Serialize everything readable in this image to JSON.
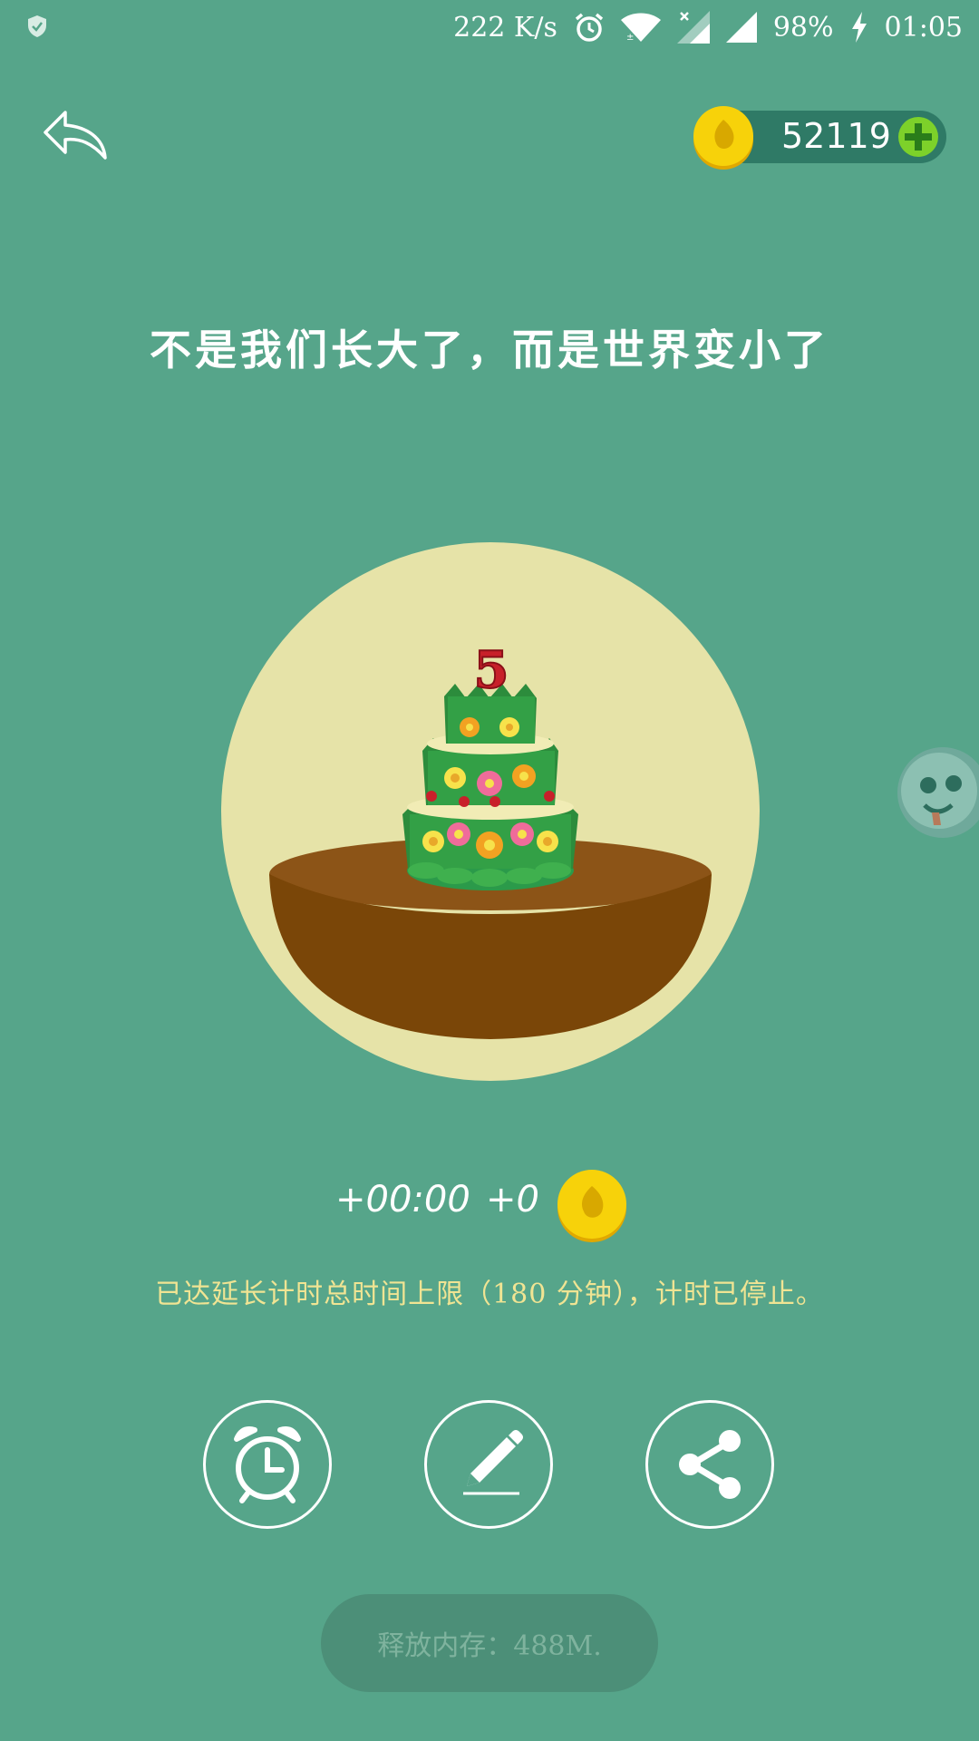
{
  "status_bar": {
    "network_speed": "222 K/s",
    "battery": "98%",
    "time": "01:05",
    "icons": [
      "shield-icon",
      "alarm-icon",
      "wifi-icon",
      "signal-no-data-icon",
      "signal-icon",
      "charging-icon"
    ]
  },
  "header": {
    "back_icon": "back-arrow-icon",
    "coin_count": "52119",
    "add_icon": "plus-icon"
  },
  "quote": "不是我们长大了，而是世界变小了",
  "tree": {
    "number": "5",
    "description_icon": "cake-tree-icon"
  },
  "timer": {
    "time_extension": "+00:00",
    "coin_gain": "+0"
  },
  "limit_notice": "已达延长计时总时间上限（180 分钟），计时已停止。",
  "actions": {
    "alarm_icon": "alarm-clock-icon",
    "note_icon": "pencil-icon",
    "share_icon": "share-icon"
  },
  "toast": "释放内存：488M.",
  "colors": {
    "background": "#56a58a",
    "circle": "#e6e3a8",
    "soil": "#7e4a0f",
    "coin": "#f7d20a",
    "notice": "#f0e493"
  }
}
